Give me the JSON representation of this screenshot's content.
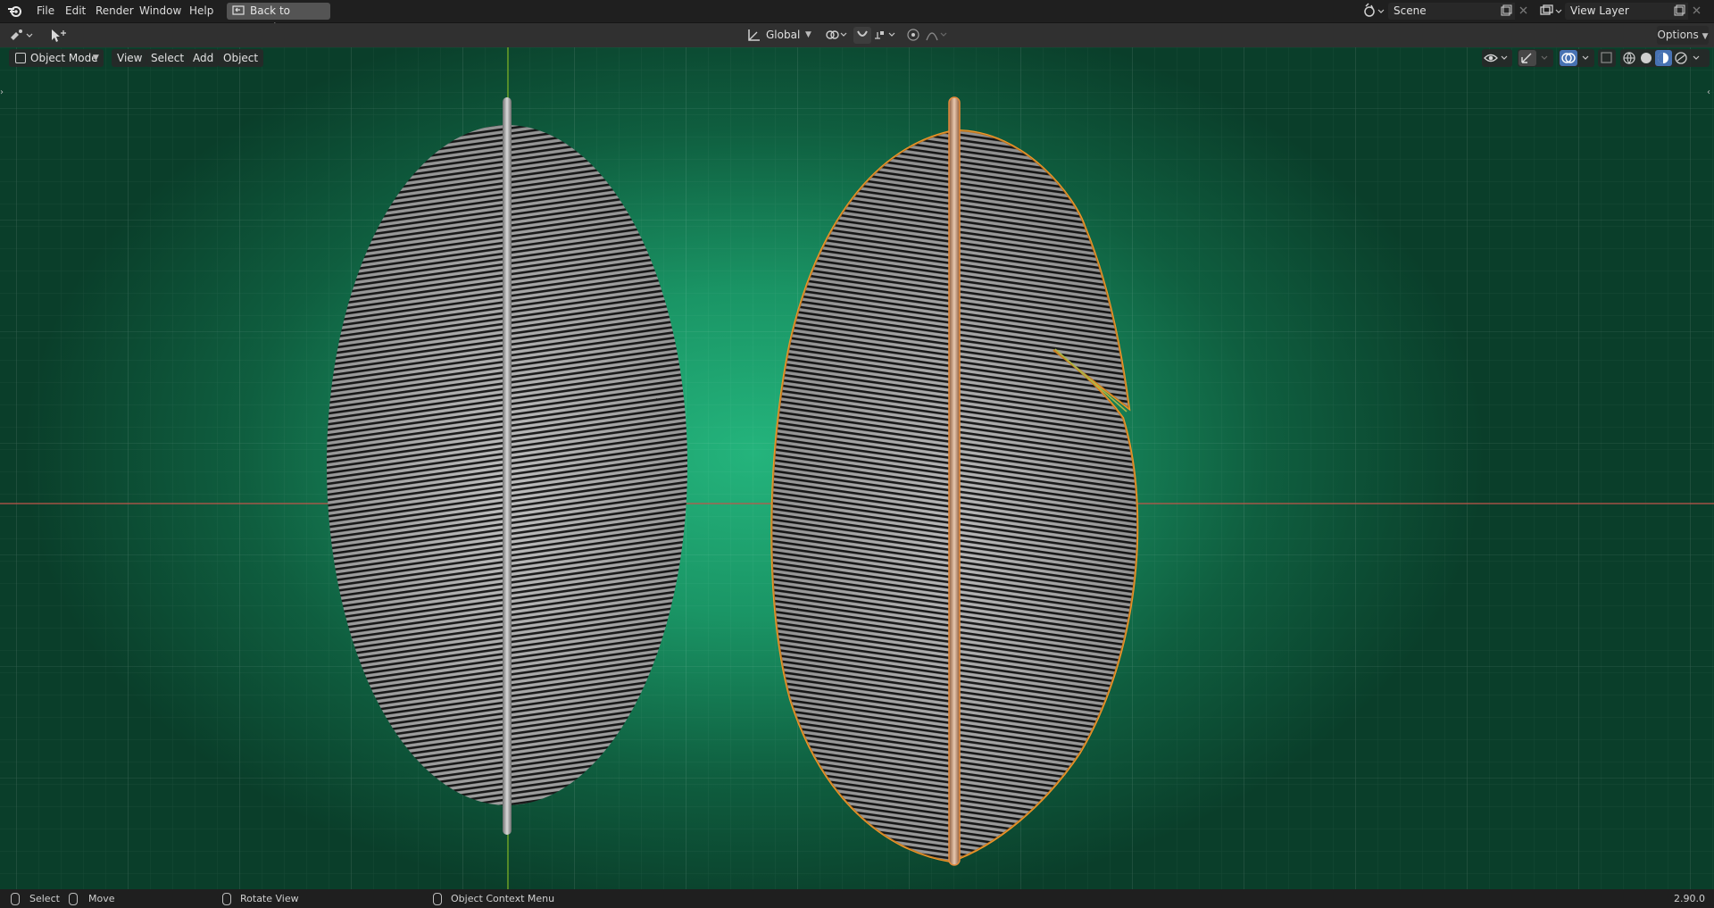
{
  "menu": {
    "file": "File",
    "edit": "Edit",
    "render": "Render",
    "window": "Window",
    "help": "Help",
    "back_to_previous": "Back to Previous"
  },
  "scene": {
    "name": "Scene"
  },
  "view_layer": {
    "name": "View Layer"
  },
  "toolbar": {
    "transform_orientation": "Global",
    "options": "Options"
  },
  "viewport": {
    "mode": "Object Mode",
    "menus": {
      "view": "View",
      "select": "Select",
      "add": "Add",
      "object": "Object"
    },
    "background_color": "#1fa874",
    "selection_outline_color": "#f0972a"
  },
  "status": {
    "select": "Select",
    "move": "Move",
    "rotate_view": "Rotate View",
    "context_menu": "Object Context Menu",
    "version": "2.90.0"
  },
  "icons": [
    "blender-logo-icon",
    "back-icon",
    "scene-icon",
    "view-layer-icon",
    "new-icon",
    "close-icon",
    "editor-type-icon",
    "cursor-tool-icon",
    "orientation-icon",
    "pivot-icon",
    "snap-icon",
    "proportional-icon",
    "visibility-icon",
    "gizmo-icon",
    "overlay-icon",
    "xray-icon",
    "wireframe-shading-icon",
    "solid-shading-icon",
    "material-shading-icon",
    "rendered-shading-icon"
  ]
}
